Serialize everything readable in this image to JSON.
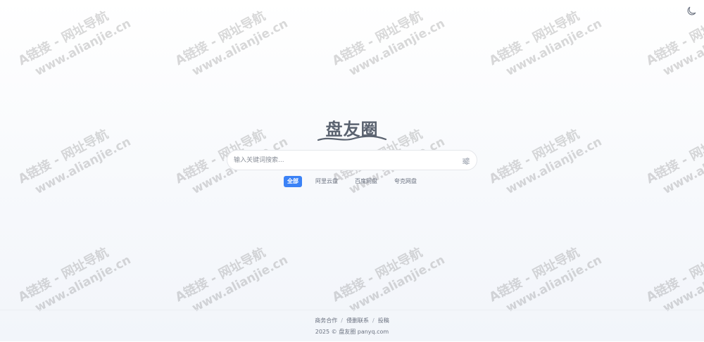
{
  "watermark": {
    "line1": "A链接 - 网址导航",
    "line2": "www.alianjie.cn"
  },
  "header": {
    "theme_toggle_icon": "moon-icon"
  },
  "logo": {
    "text": "盘友圈"
  },
  "search": {
    "placeholder": "输入关键词搜索...",
    "value": "",
    "filter_icon": "sliders-icon"
  },
  "tabs": [
    {
      "label": "全部",
      "active": true
    },
    {
      "label": "阿里云盘",
      "active": false
    },
    {
      "label": "百度网盘",
      "active": false
    },
    {
      "label": "夸克网盘",
      "active": false
    }
  ],
  "footer": {
    "links": [
      {
        "label": "商务合作"
      },
      {
        "label": "侵删联系"
      },
      {
        "label": "投稿"
      }
    ],
    "separator": "/",
    "copyright": "2025 © 盘友圈 panyq.com"
  },
  "colors": {
    "accent": "#3b82f6",
    "text_muted": "#6b7280",
    "border": "#e5e7eb"
  }
}
